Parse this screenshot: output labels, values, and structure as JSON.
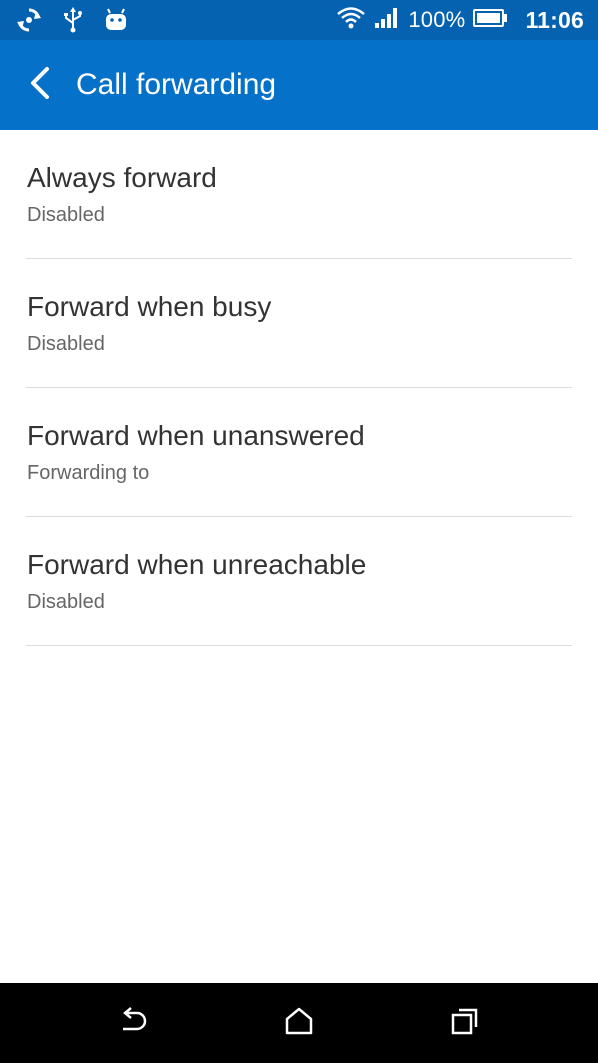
{
  "status_bar": {
    "battery_percent": "100%",
    "time": "11:06",
    "icons_left": [
      "sync-icon",
      "usb-icon",
      "android-debug-icon"
    ],
    "icons_right": [
      "wifi-icon",
      "signal-icon",
      "battery-icon"
    ]
  },
  "app_bar": {
    "title": "Call forwarding"
  },
  "settings": {
    "items": [
      {
        "title": "Always forward",
        "status": "Disabled"
      },
      {
        "title": "Forward when busy",
        "status": "Disabled"
      },
      {
        "title": "Forward when unanswered",
        "status": "Forwarding to"
      },
      {
        "title": "Forward when unreachable",
        "status": "Disabled"
      }
    ]
  },
  "nav_bar": {
    "buttons": [
      "back-icon",
      "home-icon",
      "recent-apps-icon"
    ]
  },
  "colors": {
    "status_bar": "#0562b1",
    "app_bar": "#0671c8",
    "title_text": "#333333",
    "subtitle_text": "#666666",
    "divider": "#dcdcdc",
    "nav_bar": "#000000"
  }
}
